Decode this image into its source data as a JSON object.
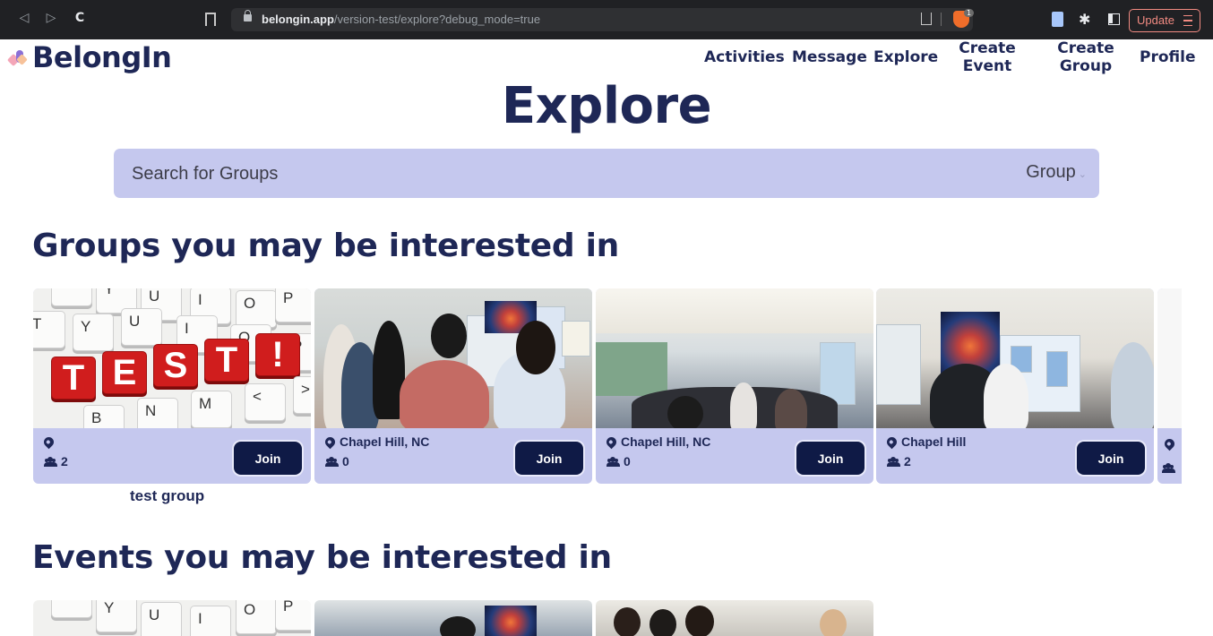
{
  "browser": {
    "url_host": "belongin.app",
    "url_path": "/version-test/explore?debug_mode=true",
    "shield_count": "1",
    "update_label": "Update"
  },
  "site": {
    "logo_text": "BelongIn",
    "nav": {
      "activities": "Activities",
      "message": "Message",
      "explore": "Explore",
      "create_event": "Create Event",
      "create_group": "Create Group",
      "profile": "Profile"
    }
  },
  "page": {
    "title": "Explore",
    "search_placeholder": "Search for Groups",
    "search_type": "Group"
  },
  "groups_section": {
    "title": "Groups you may be interested in",
    "join_label": "Join",
    "cards": [
      {
        "location": "",
        "members": "2",
        "name": "test group",
        "image": "test-keyboard"
      },
      {
        "location": "Chapel Hill, NC",
        "members": "0",
        "image": "poster-session"
      },
      {
        "location": "Chapel Hill, NC",
        "members": "0",
        "image": "hall-crowd"
      },
      {
        "location": "Chapel Hill",
        "members": "2",
        "image": "poster-art"
      }
    ]
  },
  "test_image": {
    "keys": [
      "T",
      "Y",
      "U",
      "I",
      "O",
      "P",
      "B",
      "N",
      "M",
      "<",
      ">"
    ],
    "red_keys": [
      "T",
      "E",
      "S",
      "T",
      "!"
    ]
  },
  "events_section": {
    "title": "Events you may be interested in"
  },
  "colors": {
    "brand_navy": "#1e2756",
    "card_bg": "#c5c8ee",
    "join_bg": "#0f1a46"
  }
}
